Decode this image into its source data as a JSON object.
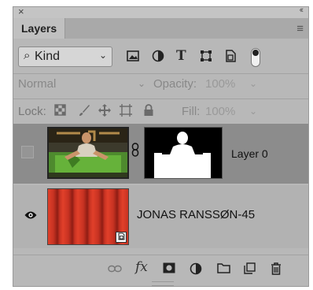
{
  "panel": {
    "tab_label": "Layers",
    "close_glyph": "×",
    "collapse_glyph": "‹‹",
    "menu_glyph": "≡"
  },
  "filter": {
    "kind_label": "Kind",
    "search_glyph": "⌕",
    "caret": "⌄",
    "icons": [
      "image-filter-icon",
      "adjustment-filter-icon",
      "type-filter-icon",
      "shape-filter-icon",
      "smart-object-filter-icon"
    ],
    "type_glyph": "T"
  },
  "blend": {
    "mode": "Normal",
    "opacity_label": "Opacity:",
    "opacity_value": "100%"
  },
  "lock": {
    "label": "Lock:",
    "fill_label": "Fill:",
    "fill_value": "100%"
  },
  "layers": [
    {
      "name": "Layer 0",
      "visible": false,
      "selected": true,
      "has_mask": true
    },
    {
      "name": "JONAS RANSSØN-45",
      "visible": true,
      "selected": false,
      "smart_object": true
    }
  ],
  "bottom": {
    "fx_label": "fx",
    "icons": [
      "link-layers-icon",
      "fx-icon",
      "add-mask-icon",
      "adjustment-layer-icon",
      "new-group-icon",
      "new-layer-icon",
      "delete-layer-icon"
    ]
  },
  "colors": {
    "panel_bg": "#b8b8b8",
    "selected_row": "#8c8c8c",
    "curtain_red": "#e1402a"
  }
}
